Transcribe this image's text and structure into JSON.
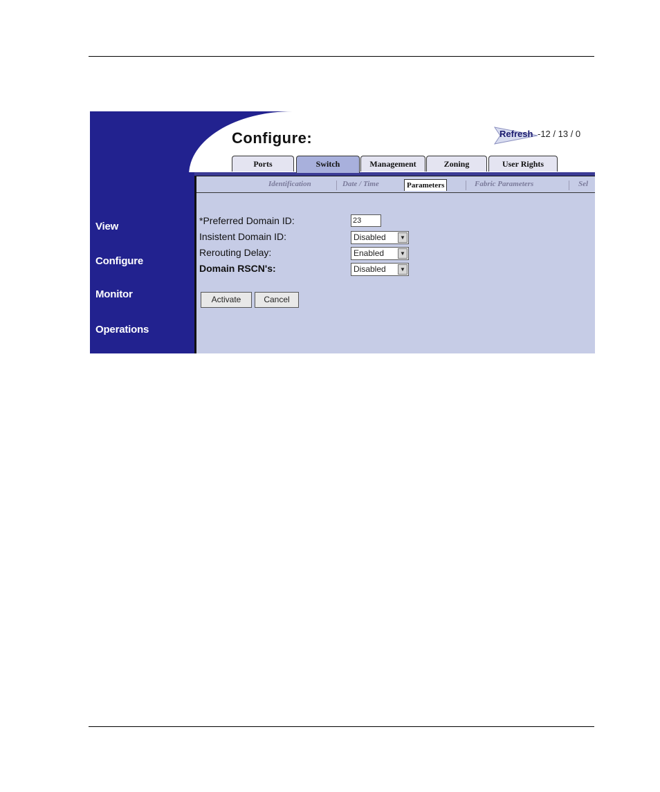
{
  "sidebar": {
    "items": [
      {
        "label": "View"
      },
      {
        "label": "Configure"
      },
      {
        "label": "Monitor"
      },
      {
        "label": "Operations"
      }
    ]
  },
  "header": {
    "title": "Configure:",
    "refresh_label": "Refresh",
    "refresh_time": "-12 / 13 / 0"
  },
  "tabs": [
    {
      "label": "Ports"
    },
    {
      "label": "Switch",
      "active": true
    },
    {
      "label": "Management"
    },
    {
      "label": "Zoning"
    },
    {
      "label": "User Rights"
    }
  ],
  "subtabs": [
    {
      "label": "Identification"
    },
    {
      "label": "Date / Time"
    },
    {
      "label": "Parameters",
      "active": true
    },
    {
      "label": "Fabric Parameters"
    },
    {
      "label": "Sel"
    }
  ],
  "form": {
    "preferred_domain_id": {
      "label": "*Preferred Domain ID:",
      "value": "23"
    },
    "insistent_domain_id": {
      "label": "Insistent Domain ID:",
      "value": "Disabled"
    },
    "rerouting_delay": {
      "label": "Rerouting Delay:",
      "value": "Enabled"
    },
    "domain_rscns": {
      "label": "Domain RSCN's:",
      "value": "Disabled"
    }
  },
  "buttons": {
    "activate": "Activate",
    "cancel": "Cancel"
  },
  "colors": {
    "chrome_blue": "#22228f",
    "panel_bg": "#c6cce6",
    "active_tab": "#a8b0dc"
  }
}
